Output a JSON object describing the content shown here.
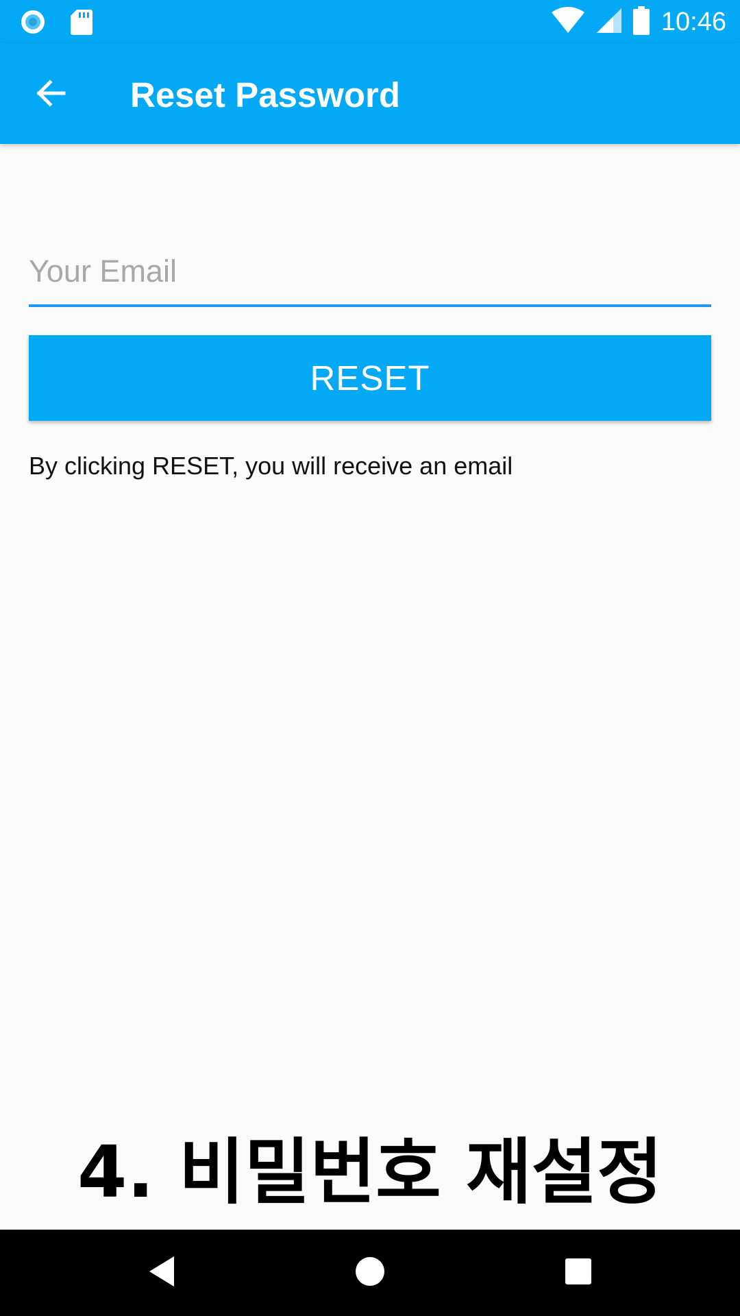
{
  "status_bar": {
    "time": "10:46",
    "icons": [
      "app-notification-icon",
      "sd-card-icon",
      "wifi-icon",
      "cell-signal-icon",
      "battery-icon"
    ]
  },
  "app_bar": {
    "title": "Reset Password",
    "back_icon": "arrow-back-icon"
  },
  "form": {
    "email_placeholder": "Your Email",
    "email_value": "",
    "reset_label": "RESET",
    "info_text": "By clicking RESET, you will receive an email"
  },
  "caption": "4. 비밀번호 재설정",
  "nav_bar": {
    "icons": [
      "back-triangle-icon",
      "home-circle-icon",
      "recents-square-icon"
    ]
  },
  "colors": {
    "primary": "#03a9f4",
    "underline": "#2196f3",
    "background": "#fafafa"
  }
}
